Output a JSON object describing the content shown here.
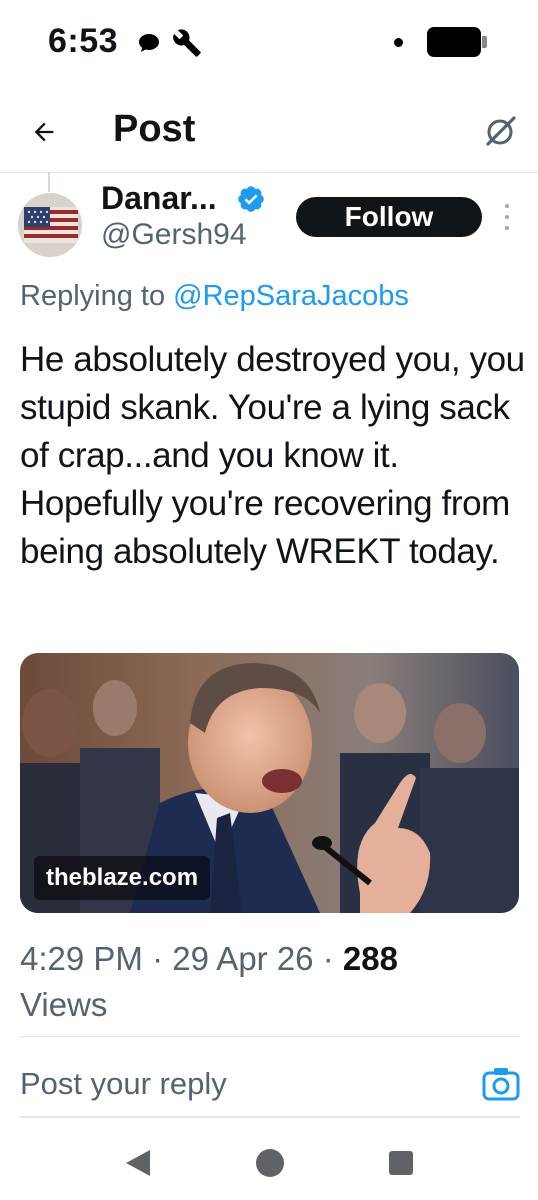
{
  "status_bar": {
    "time": "6:53",
    "icons": [
      "chat-bubble-icon",
      "wrench-icon",
      "dot-icon",
      "battery-icon"
    ]
  },
  "header": {
    "title": "Post",
    "back_icon": "arrow-left-icon",
    "action_icon": "grok-icon"
  },
  "author": {
    "display_name": "Danar...",
    "handle": "@Gersh94",
    "verified": true,
    "follow_label": "Follow"
  },
  "reply_context": {
    "prefix": "Replying to",
    "mention": "@RepSaraJacobs"
  },
  "tweet": {
    "text": "He absolutely destroyed you, you stupid skank.  You're a lying sack of crap...and you know it. Hopefully you're recovering from being absolutely WREKT today."
  },
  "media": {
    "domain": "theblaze.com"
  },
  "meta": {
    "time": "4:29 PM",
    "date": "29 Apr 26",
    "separator": "·",
    "views_count": "288",
    "views_label": "Views"
  },
  "composer": {
    "placeholder": "Post your reply",
    "camera_icon": "camera-icon"
  },
  "nav_bar": {
    "icons": [
      "back-triangle-icon",
      "home-circle-icon",
      "recents-square-icon"
    ]
  },
  "colors": {
    "link": "#1d9bf0",
    "text": "#0f1419",
    "secondary": "#536471",
    "follow_bg": "#0f1419"
  }
}
